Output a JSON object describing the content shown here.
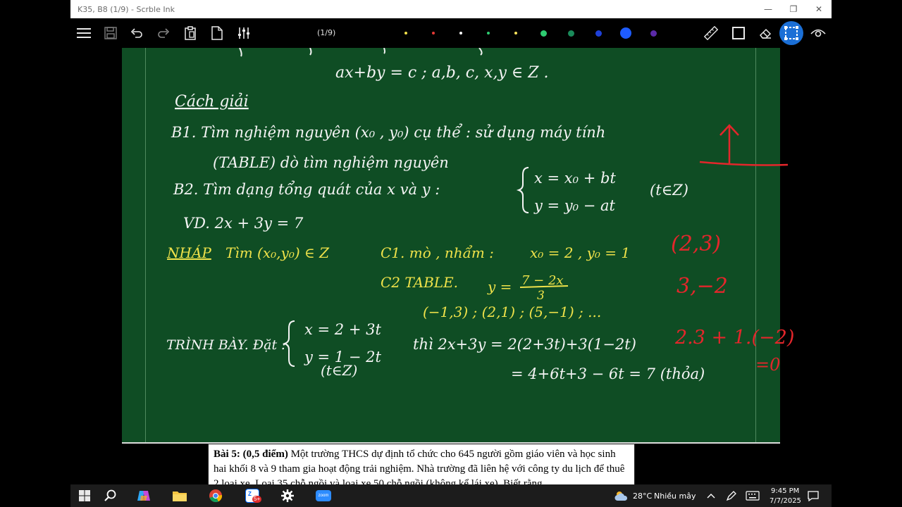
{
  "window": {
    "title": "K35, B8 (1/9) - Scrble Ink",
    "minimize": "—",
    "restore": "❐",
    "close": "✕"
  },
  "toolbar": {
    "page_indicator": "(1/9)",
    "pen_colors": [
      "#f1e04a",
      "#e53935",
      "#ffffff",
      "#2ecc71",
      "#ffe45c",
      "#2ecc71",
      "#1a8a5a",
      "#1e40d8",
      "#1e5cff",
      "#5b2aa8"
    ],
    "icons": [
      "menu-icon",
      "save-icon",
      "undo-icon",
      "redo-icon",
      "paste-icon",
      "page-icon",
      "settings-sliders-icon",
      "ruler-icon",
      "rectangle-icon",
      "eraser-icon",
      "selection-icon",
      "eye-icon"
    ],
    "active_color": "#1b6fd6"
  },
  "board": {
    "white_lines": [
      "ax+by = c ;   a,b, c, x,y ∈ Z .",
      "Cách giải",
      "B1. Tìm nghiệm nguyên (x₀ , y₀) cụ thể : sử dụng máy tính",
      "(TABLE) dò tìm nghiệm nguyên",
      "B2. Tìm dạng tổng quát của x và y :",
      "x =  x₀ + bt",
      "y =  y₀ − at",
      "(t∈Z)",
      "VD.  2x + 3y = 7",
      "TRÌNH BÀY.  Đặt :",
      "x = 2 + 3t",
      "y = 1 − 2t",
      "(t∈Z)",
      "thì   2x+3y = 2(2+3t)+3(1−2t)",
      "= 4+6t+3 − 6t = 7 (thỏa)"
    ],
    "yellow_lines": [
      "NHÁP",
      "Tìm (x₀,y₀) ∈ Z",
      "C1.  mò , nhẩm :",
      "x₀ = 2 ,  y₀ = 1",
      "C2   TABLE.",
      "y =",
      "7 − 2x",
      "3",
      "(−1,3) ; (2,1) ; (5,−1) ; ..."
    ],
    "red_lines": [
      "(2,3)",
      "3,−2",
      "2.3 + 1.(−2)",
      "=0"
    ]
  },
  "doc": {
    "label": "Bài 5:",
    "points": "(0,5 điểm)",
    "text": "Một trường THCS dự định tổ chức cho 645 người gồm giáo viên và học sinh hai khối 8  và 9 tham gia hoạt động trải nghiệm. Nhà trường đã liên hệ với công ty du lịch để thuê 2 loại xe. Loại 35 chỗ ngồi và loại xe 50 chỗ ngồi (không kể lái xe). Biết rằng"
  },
  "taskbar": {
    "apps": [
      "windows-start-icon",
      "search-icon",
      "copilot-icon",
      "file-explorer-icon",
      "chrome-icon",
      "zalo-icon",
      "settings-gear-icon",
      "zoom-icon"
    ],
    "zalo_badge": "5+",
    "zoom_label": "zoom",
    "weather_temp": "28°C",
    "weather_desc": "Nhiều mây",
    "time": "9:45 PM",
    "date": "7/7/2025"
  }
}
